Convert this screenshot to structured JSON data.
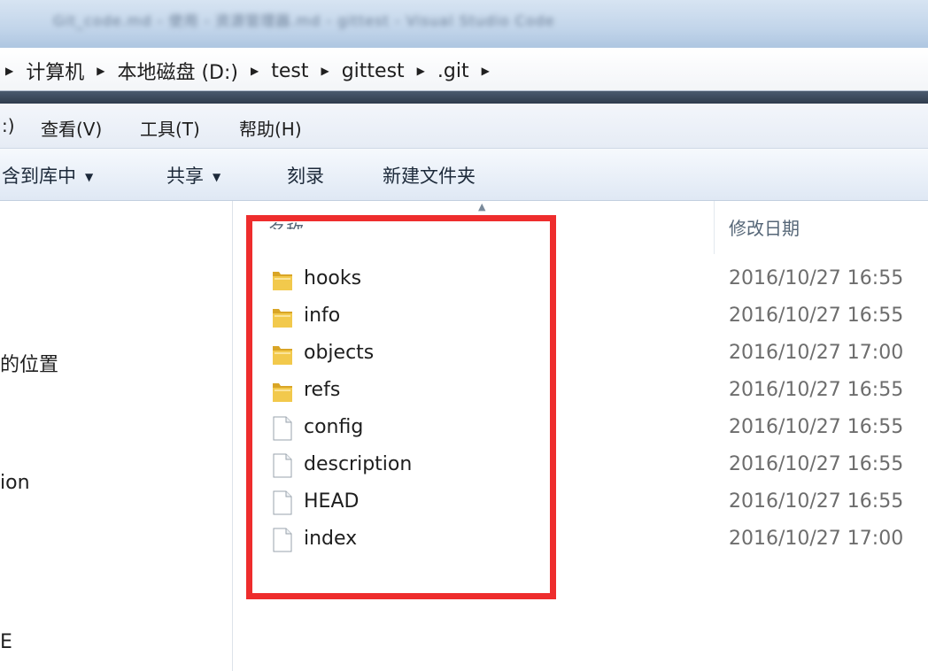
{
  "titlebar": {
    "blurred_text": "Git_code.md - 使用 - 资源管理器.md - gittest - Visual Studio Code"
  },
  "breadcrumb": [
    "计算机",
    "本地磁盘 (D:)",
    "test",
    "gittest",
    ".git"
  ],
  "menu": {
    "items": [
      ":)",
      "查看(V)",
      "工具(T)",
      "帮助(H)"
    ]
  },
  "toolbar": {
    "include_library": "含到库中",
    "share": "共享",
    "burn": "刻录",
    "new_folder": "新建文件夹"
  },
  "nav": {
    "items": [
      "的位置",
      "ion",
      "E"
    ]
  },
  "columns": {
    "name": "名称",
    "date_modified": "修改日期"
  },
  "files": [
    {
      "name": "hooks",
      "type": "folder",
      "modified": "2016/10/27 16:55"
    },
    {
      "name": "info",
      "type": "folder",
      "modified": "2016/10/27 16:55"
    },
    {
      "name": "objects",
      "type": "folder",
      "modified": "2016/10/27 17:00"
    },
    {
      "name": "refs",
      "type": "folder",
      "modified": "2016/10/27 16:55"
    },
    {
      "name": "config",
      "type": "file",
      "modified": "2016/10/27 16:55"
    },
    {
      "name": "description",
      "type": "file",
      "modified": "2016/10/27 16:55"
    },
    {
      "name": "HEAD",
      "type": "file",
      "modified": "2016/10/27 16:55"
    },
    {
      "name": "index",
      "type": "file",
      "modified": "2016/10/27 17:00"
    }
  ],
  "colors": {
    "highlight_border": "#ee2d2d",
    "folder": "#e8b83a"
  }
}
